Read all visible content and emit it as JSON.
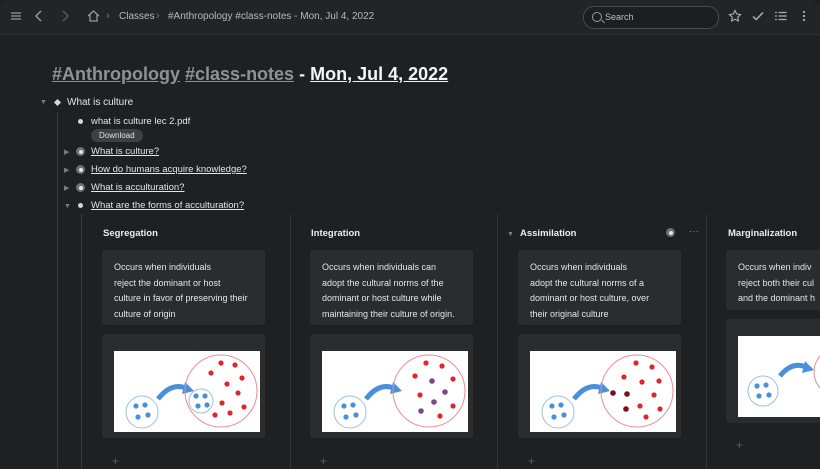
{
  "breadcrumb": {
    "parent": "Classes",
    "current": "#Anthropology #class-notes - Mon, Jul 4, 2022"
  },
  "search": {
    "placeholder": "Search"
  },
  "page": {
    "tag1": "#Anthropology",
    "tag2": "#class-notes",
    "dash": " - ",
    "date": "Mon, Jul 4, 2022"
  },
  "outline": {
    "root": "What is culture",
    "file": "what is culture lec 2.pdf",
    "download": "Download",
    "q1": "What is culture?",
    "q2": "How do humans acquire knowledge?",
    "q3": "What is acculturation?",
    "q4": "What are the forms of acculturation?"
  },
  "columns": [
    {
      "title": "Segregation",
      "lines": [
        "Occurs when individuals",
        "reject the dominant or host",
        "culture in favor of preserving their",
        "culture of origin"
      ]
    },
    {
      "title": "Integration",
      "lines": [
        "Occurs when individuals can",
        "adopt the cultural norms of the",
        "dominant or host culture while",
        "maintaining their culture of origin."
      ]
    },
    {
      "title": "Assimilation",
      "lines": [
        "Occurs when individuals",
        "adopt the cultural norms of a",
        "dominant or host culture, over",
        "their original culture"
      ]
    },
    {
      "title": "Marginalization",
      "lines": [
        "Occurs when indiv",
        "reject both their cul",
        "and the dominant h"
      ]
    }
  ],
  "colors": {
    "accent_red": "#e0262b",
    "accent_blue": "#4a90d9",
    "background": "#1f2022"
  },
  "icons": [
    "menu-icon",
    "back-icon",
    "forward-icon",
    "home-icon",
    "search-icon",
    "star-icon",
    "check-icon",
    "list-icon",
    "more-icon"
  ]
}
